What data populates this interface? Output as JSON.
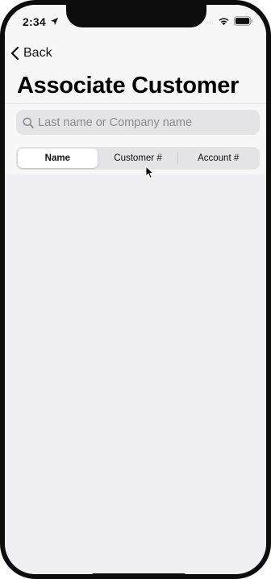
{
  "status_bar": {
    "time": "2:34",
    "signal": "....",
    "icons": [
      "location-arrow-icon",
      "wifi-icon",
      "battery-icon"
    ]
  },
  "nav": {
    "back_label": "Back",
    "back_icon": "chevron-left-icon"
  },
  "page": {
    "title": "Associate Customer"
  },
  "search": {
    "placeholder": "Last name or Company name",
    "value": "",
    "icon": "search-icon"
  },
  "segmented_control": {
    "selected": "Name",
    "segments": [
      {
        "label": "Name"
      },
      {
        "label": "Customer #"
      },
      {
        "label": "Account #"
      }
    ]
  },
  "colors": {
    "background": "#efeff4",
    "header_background": "#f7f7f8",
    "search_field": "#e4e4e7",
    "text": "#000000",
    "placeholder": "#8a8a8e"
  }
}
